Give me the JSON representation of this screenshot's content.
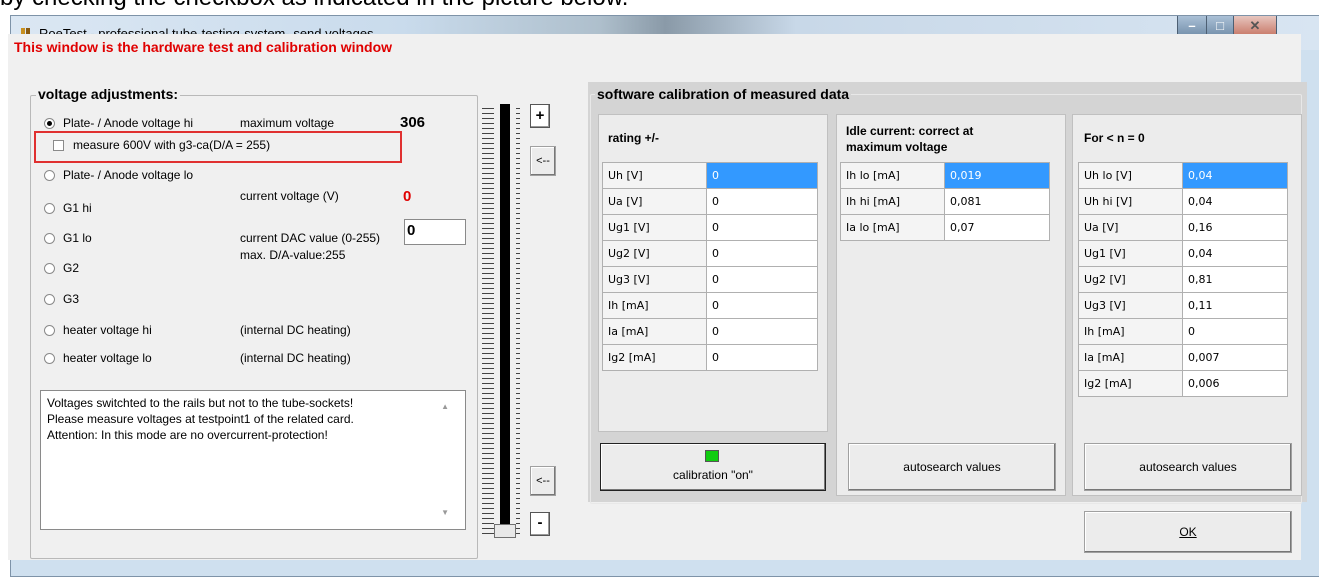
{
  "caption": "by checking the checkbox as indicated in the picture below.",
  "window": {
    "title": "RoeTest - professional tube-testing-system- send voltages"
  },
  "banner": "This window is the hardware test and calibration window",
  "voltage_adjustments": {
    "title": "voltage adjustments:",
    "radios": [
      {
        "label": "Plate- / Anode voltage hi",
        "checked": true
      },
      {
        "label": "Plate- / Anode voltage lo",
        "checked": false
      },
      {
        "label": "G1 hi",
        "checked": false
      },
      {
        "label": "G1 lo",
        "checked": false
      },
      {
        "label": "G2",
        "checked": false
      },
      {
        "label": "G3",
        "checked": false
      },
      {
        "label": "heater voltage hi",
        "checked": false
      },
      {
        "label": "heater voltage lo",
        "checked": false
      }
    ],
    "checkbox_label": "measure 600V with g3-ca(D/A = 255)",
    "max_voltage_label": "maximum voltage",
    "max_voltage_value": "306",
    "current_voltage_label": "current voltage (V)",
    "current_voltage_value": "0",
    "dac_label": "current DAC value (0-255)",
    "dac_value": "0",
    "max_da_label": "max. D/A-value:255",
    "internal_dc_1": "(internal DC heating)",
    "internal_dc_2": "(internal DC heating)",
    "memo_lines": [
      "Voltages switchted to the rails but not to the tube-sockets!",
      "Please measure voltages at testpoint1 of the related card.",
      "Attention: In this mode are no overcurrent-protection!"
    ]
  },
  "slider_buttons": {
    "plus": "+",
    "left_top": "<--",
    "left_bottom": "<--",
    "minus": "-"
  },
  "calibration": {
    "title": "software calibration of measured data",
    "rating": {
      "title": "rating +/-",
      "rows": [
        {
          "label": "Uh  [V]",
          "value": "0"
        },
        {
          "label": "Ua  [V]",
          "value": "0"
        },
        {
          "label": "Ug1 [V]",
          "value": "0"
        },
        {
          "label": "Ug2  [V]",
          "value": "0"
        },
        {
          "label": "Ug3  [V]",
          "value": "0"
        },
        {
          "label": "Ih    [mA]",
          "value": "0"
        },
        {
          "label": "Ia    [mA]",
          "value": "0"
        },
        {
          "label": "Ig2  [mA]",
          "value": "0"
        }
      ],
      "button_label": "calibration \"on\"",
      "indicator_color": "#11cc11"
    },
    "idle": {
      "title_line1": "Idle current: correct at",
      "title_line2": "maximum voltage",
      "rows": [
        {
          "label": "Ih lo [mA]",
          "value": "0,019"
        },
        {
          "label": "Ih hi [mA]",
          "value": "0,081"
        },
        {
          "label": "Ia lo [mA]",
          "value": "0,07"
        }
      ],
      "button_label": "autosearch values"
    },
    "n0": {
      "title": "For < n = 0",
      "rows": [
        {
          "label": "Uh lo [V]",
          "value": "0,04"
        },
        {
          "label": "Uh hi [V]",
          "value": "0,04"
        },
        {
          "label": "Ua    [V]",
          "value": "0,16"
        },
        {
          "label": "Ug1   [V]",
          "value": "0,04"
        },
        {
          "label": "Ug2   [V]",
          "value": "0,81"
        },
        {
          "label": "Ug3   [V]",
          "value": "0,11"
        },
        {
          "label": "Ih      [mA]",
          "value": "0"
        },
        {
          "label": "Ia      [mA]",
          "value": "0,007"
        },
        {
          "label": "Ig2    [mA]",
          "value": "0,006"
        }
      ],
      "button_label": "autosearch values"
    }
  },
  "ok_label": "OK",
  "colors": {
    "red": "#e00000",
    "selected": "#3399ff"
  }
}
